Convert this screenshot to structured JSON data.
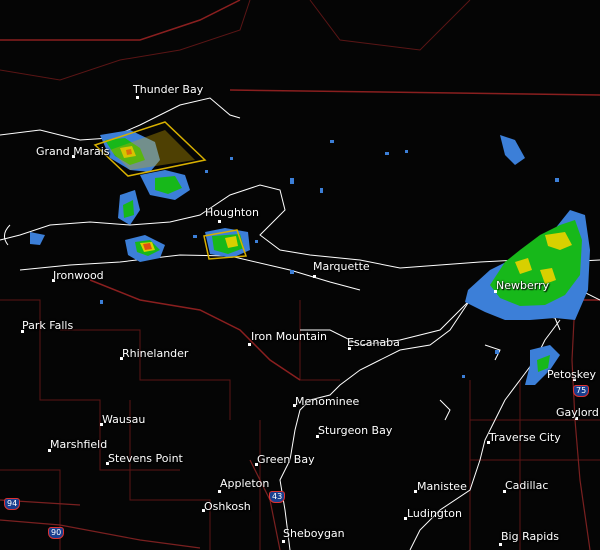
{
  "cities": [
    {
      "id": "thunder-bay",
      "label": "Thunder Bay"
    },
    {
      "id": "grand-marais",
      "label": "Grand Marais"
    },
    {
      "id": "houghton",
      "label": "Houghton"
    },
    {
      "id": "ironwood",
      "label": "Ironwood"
    },
    {
      "id": "marquette",
      "label": "Marquette"
    },
    {
      "id": "newberry",
      "label": "Newberry"
    },
    {
      "id": "park-falls",
      "label": "Park Falls"
    },
    {
      "id": "iron-mountain",
      "label": "Iron Mountain"
    },
    {
      "id": "escanaba",
      "label": "Escanaba"
    },
    {
      "id": "rhinelander",
      "label": "Rhinelander"
    },
    {
      "id": "petoskey",
      "label": "Petoskey"
    },
    {
      "id": "menominee",
      "label": "Menominee"
    },
    {
      "id": "gaylord",
      "label": "Gaylord"
    },
    {
      "id": "wausau",
      "label": "Wausau"
    },
    {
      "id": "sturgeon-bay",
      "label": "Sturgeon Bay"
    },
    {
      "id": "traverse-city",
      "label": "Traverse City"
    },
    {
      "id": "marshfield",
      "label": "Marshfield"
    },
    {
      "id": "stevens-point",
      "label": "Stevens Point"
    },
    {
      "id": "green-bay",
      "label": "Green Bay"
    },
    {
      "id": "appleton",
      "label": "Appleton"
    },
    {
      "id": "manistee",
      "label": "Manistee"
    },
    {
      "id": "cadillac",
      "label": "Cadillac"
    },
    {
      "id": "oshkosh",
      "label": "Oshkosh"
    },
    {
      "id": "ludington",
      "label": "Ludington"
    },
    {
      "id": "sheboygan",
      "label": "Sheboygan"
    },
    {
      "id": "big-rapids",
      "label": "Big Rapids"
    }
  ],
  "shields": {
    "i75": "75",
    "i43": "43",
    "i94": "94",
    "i90": "90"
  },
  "colors": {
    "background": "#050505",
    "state_border": "#8a1f1f",
    "coastline": "#ffffff",
    "warning_box": "#d8b000",
    "radar_light": "#3c7fd8",
    "radar_moderate": "#17b81a",
    "radar_heavy": "#d8d000",
    "radar_intense": "#e05010"
  }
}
